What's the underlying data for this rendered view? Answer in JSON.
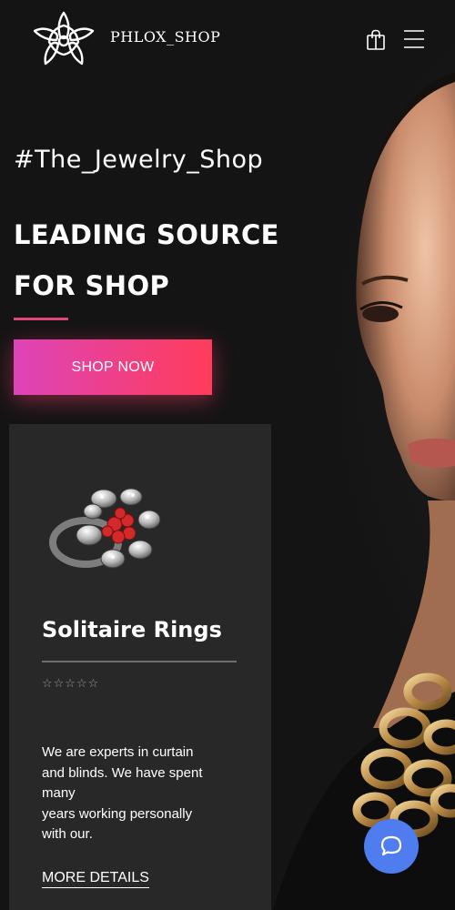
{
  "brand": {
    "name": "PHLOX_SHOP",
    "logo": "flower-logo-icon"
  },
  "header": {
    "cart_icon": "shopping-bag-icon",
    "menu_icon": "hamburger-menu-icon"
  },
  "hero": {
    "hashtag": "#The_Jewelry_Shop",
    "headline_line1": "LEADING SOURCE",
    "headline_line2": "FOR SHOP",
    "cta_label": "SHOP NOW",
    "accent_color": "#e0457b",
    "cta_gradient": [
      "#dd44b8",
      "#ff3c5a"
    ]
  },
  "product_card": {
    "image": "ring-icon",
    "title": "Solitaire Rings",
    "rating": "☆☆☆☆☆",
    "description": "We are experts in curtain\nand blinds. We have spent\nmany\nyears working personally\nwith our.",
    "link_label": "MORE DETAILS"
  },
  "chat": {
    "icon": "chat-bubble-icon",
    "color": "#4f7df0"
  }
}
